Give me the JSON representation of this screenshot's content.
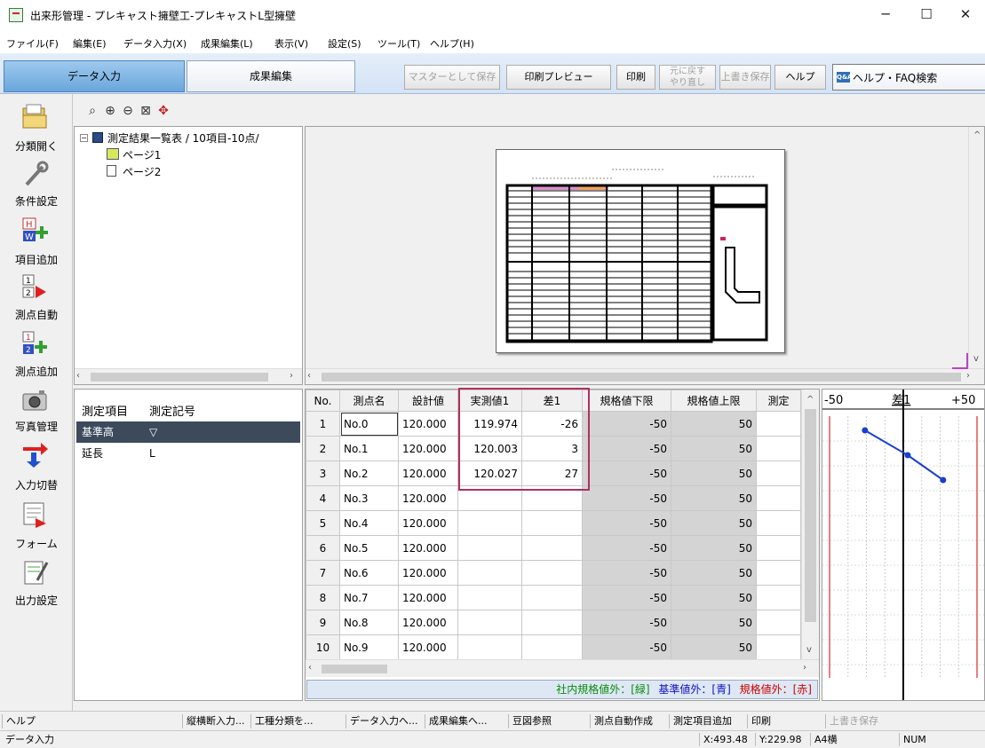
{
  "window": {
    "title": "出来形管理 - プレキャスト擁壁工-プレキャストL型擁壁",
    "min": "─",
    "max": "☐",
    "close": "✕"
  },
  "menu": [
    "ファイル(F)",
    "編集(E)",
    "データ入力(X)",
    "成果編集(L)",
    "表示(V)",
    "設定(S)",
    "ツール(T)",
    "ヘルプ(H)"
  ],
  "modes": {
    "data_input": "データ入力",
    "result_edit": "成果編集"
  },
  "toolbar": {
    "save_master": "マスターとして保存",
    "print_preview": "印刷プレビュー",
    "print": "印刷",
    "undo": "元に戻す",
    "redo": "やり直し",
    "overwrite": "上書き保存",
    "help": "ヘルプ",
    "qa": "Q&A",
    "faq": "ヘルプ・FAQ検索"
  },
  "left": [
    "分類開く",
    "条件設定",
    "項目追加",
    "測点自動",
    "測点追加",
    "写真管理",
    "入力切替",
    "フォーム",
    "出力設定"
  ],
  "icons": {
    "add_item_letters_top": "H",
    "add_item_letters_bot": "W",
    "auto_pt_1": "1",
    "auto_pt_2": "2",
    "add_pt_1": "1",
    "add_pt_2": "2"
  },
  "tree": {
    "root": "測定結果一覧表 / 10項目-10点/",
    "pages": [
      "ページ1",
      "ページ2"
    ]
  },
  "items_header": {
    "item": "測定項目",
    "symbol": "測定記号"
  },
  "items": [
    {
      "name": "基準高",
      "symbol": "▽"
    },
    {
      "name": "延長",
      "symbol": "L"
    }
  ],
  "grid": {
    "headers": [
      "No.",
      "測点名",
      "設計値",
      "実測値1",
      "差1",
      "規格値下限",
      "規格値上限",
      "測定"
    ],
    "rows": [
      {
        "no": "1",
        "name": "No.0",
        "design": "120.000",
        "actual": "119.974",
        "diff": "-26",
        "lower": "-50",
        "upper": "50"
      },
      {
        "no": "2",
        "name": "No.1",
        "design": "120.000",
        "actual": "120.003",
        "diff": "3",
        "lower": "-50",
        "upper": "50"
      },
      {
        "no": "3",
        "name": "No.2",
        "design": "120.000",
        "actual": "120.027",
        "diff": "27",
        "lower": "-50",
        "upper": "50"
      },
      {
        "no": "4",
        "name": "No.3",
        "design": "120.000",
        "actual": "",
        "diff": "",
        "lower": "-50",
        "upper": "50"
      },
      {
        "no": "5",
        "name": "No.4",
        "design": "120.000",
        "actual": "",
        "diff": "",
        "lower": "-50",
        "upper": "50"
      },
      {
        "no": "6",
        "name": "No.5",
        "design": "120.000",
        "actual": "",
        "diff": "",
        "lower": "-50",
        "upper": "50"
      },
      {
        "no": "7",
        "name": "No.6",
        "design": "120.000",
        "actual": "",
        "diff": "",
        "lower": "-50",
        "upper": "50"
      },
      {
        "no": "8",
        "name": "No.7",
        "design": "120.000",
        "actual": "",
        "diff": "",
        "lower": "-50",
        "upper": "50"
      },
      {
        "no": "9",
        "name": "No.8",
        "design": "120.000",
        "actual": "",
        "diff": "",
        "lower": "-50",
        "upper": "50"
      },
      {
        "no": "10",
        "name": "No.9",
        "design": "120.000",
        "actual": "",
        "diff": "",
        "lower": "-50",
        "upper": "50"
      }
    ]
  },
  "legend": {
    "green": "社内規格値外：[緑]",
    "blue": "基準値外：[青]",
    "red": "規格値外：[赤]"
  },
  "colors": {
    "green": "#0a8a0a",
    "blue": "#1010c0",
    "red": "#d00000",
    "point": "#1a3fd0"
  },
  "chart_data": {
    "type": "line",
    "title": "差1",
    "xlim": [
      -50,
      50
    ],
    "x_tick_labels": [
      "-50",
      "+50"
    ],
    "x": [
      -26,
      3,
      27
    ]
  },
  "taskbar": [
    "ヘルプ",
    "縦横断入力...",
    "工種分類を...",
    "データ入力へ...",
    "成果編集へ...",
    "豆図参照",
    "測点自動作成",
    "測定項目追加",
    "印刷",
    "上書き保存"
  ],
  "status": {
    "mode": "データ入力",
    "x": "X:493.48",
    "y": "Y:229.98",
    "paper": "A4横",
    "num": "NUM"
  }
}
